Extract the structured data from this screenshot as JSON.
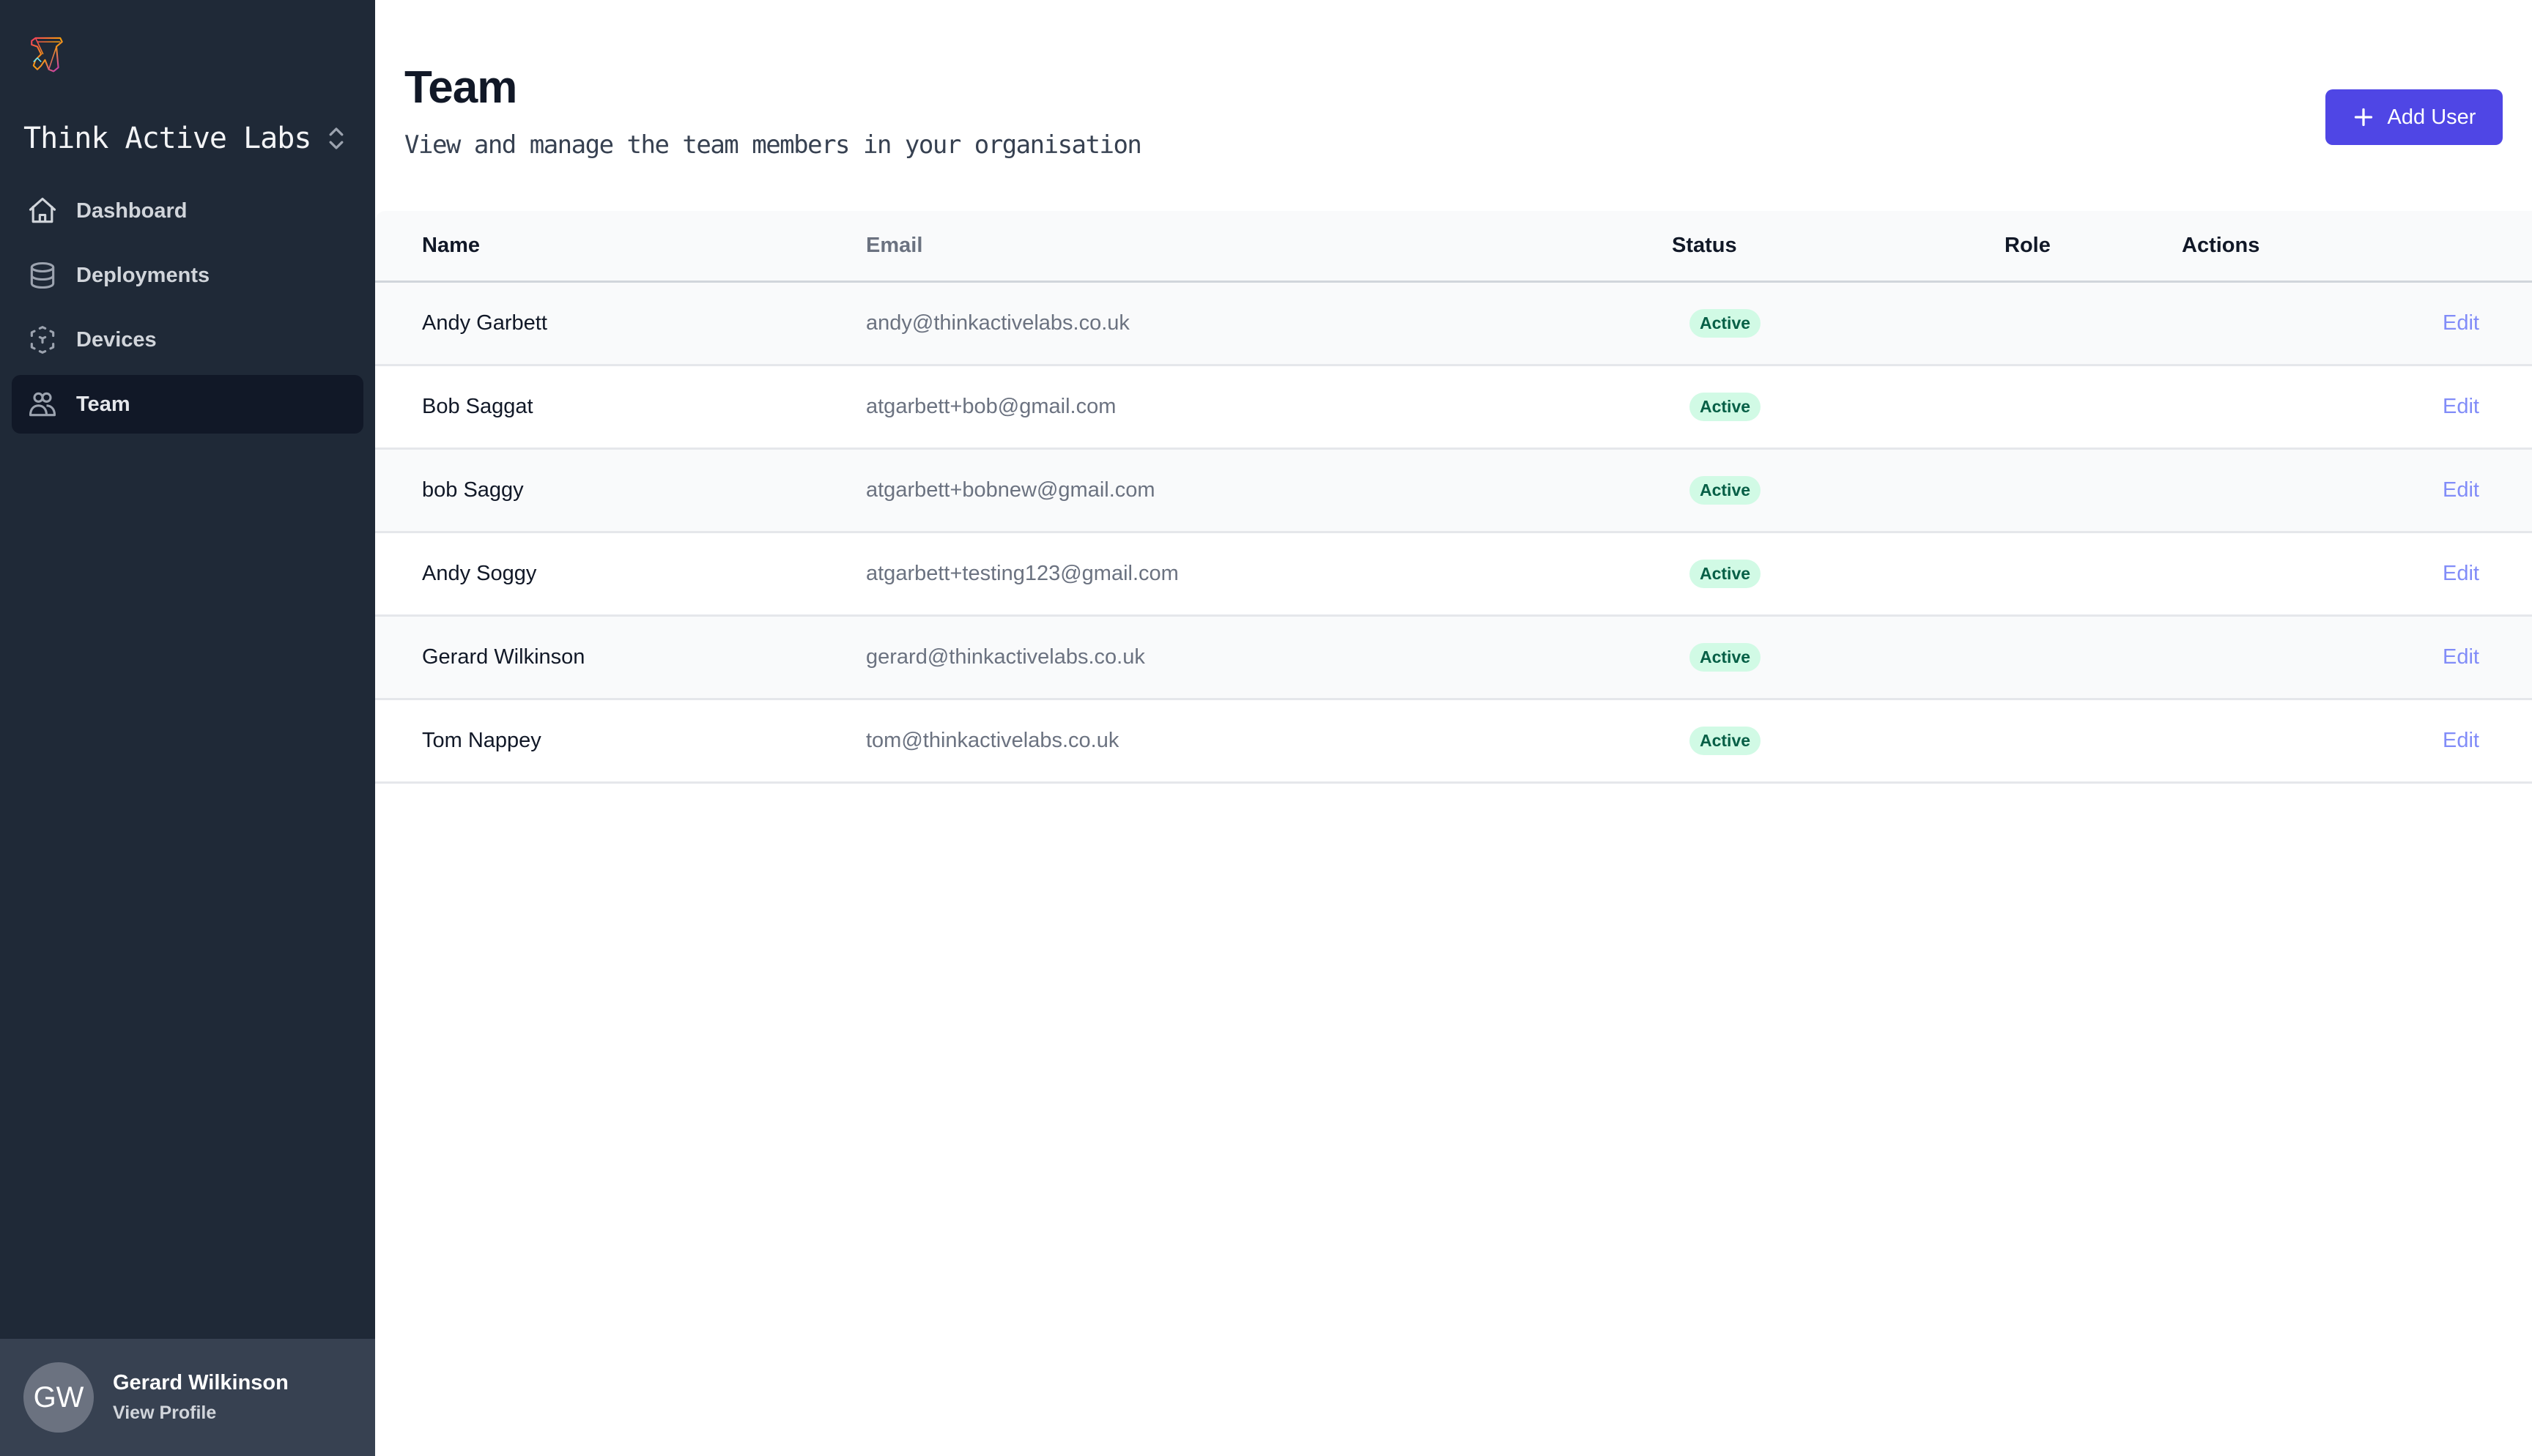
{
  "sidebar": {
    "org_name": "Think Active Labs",
    "items": [
      {
        "label": "Dashboard",
        "icon": "home-icon",
        "active": false
      },
      {
        "label": "Deployments",
        "icon": "database-icon",
        "active": false
      },
      {
        "label": "Devices",
        "icon": "cube-transparent-icon",
        "active": false
      },
      {
        "label": "Team",
        "icon": "users-icon",
        "active": true
      }
    ],
    "profile": {
      "initials": "GW",
      "name": "Gerard Wilkinson",
      "link": "View Profile"
    }
  },
  "header": {
    "title": "Team",
    "subtitle": "View and manage the team members in your organisation",
    "add_button": "Add User"
  },
  "table": {
    "columns": [
      "Name",
      "Email",
      "Status",
      "Role",
      "Actions"
    ],
    "rows": [
      {
        "name": "Andy Garbett",
        "email": "andy@thinkactivelabs.co.uk",
        "status": "Active",
        "role": "",
        "action": "Edit"
      },
      {
        "name": "Bob Saggat",
        "email": "atgarbett+bob@gmail.com",
        "status": "Active",
        "role": "",
        "action": "Edit"
      },
      {
        "name": "bob Saggy",
        "email": "atgarbett+bobnew@gmail.com",
        "status": "Active",
        "role": "",
        "action": "Edit"
      },
      {
        "name": "Andy Soggy",
        "email": "atgarbett+testing123@gmail.com",
        "status": "Active",
        "role": "",
        "action": "Edit"
      },
      {
        "name": "Gerard Wilkinson",
        "email": "gerard@thinkactivelabs.co.uk",
        "status": "Active",
        "role": "",
        "action": "Edit"
      },
      {
        "name": "Tom Nappey",
        "email": "tom@thinkactivelabs.co.uk",
        "status": "Active",
        "role": "",
        "action": "Edit"
      }
    ]
  },
  "colors": {
    "sidebar_bg": "#1f2937",
    "accent": "#4f46e5",
    "badge_bg": "#d1fae5",
    "badge_text": "#065f46",
    "link": "#818cf8"
  }
}
